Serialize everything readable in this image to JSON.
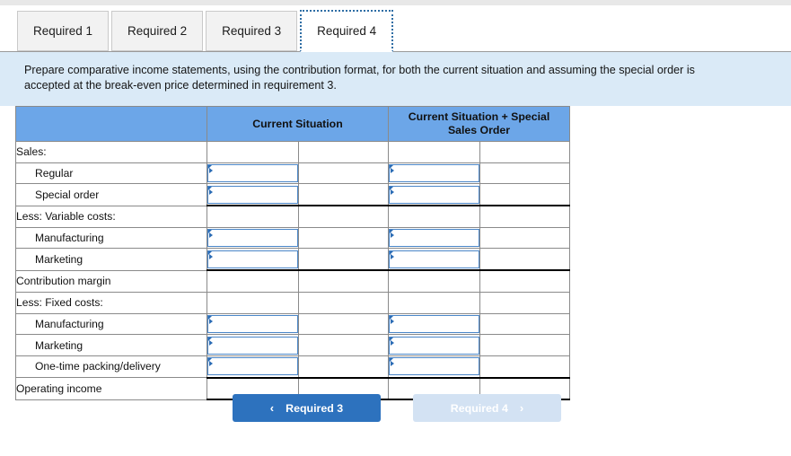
{
  "tabs": [
    {
      "label": "Required 1",
      "active": false
    },
    {
      "label": "Required 2",
      "active": false
    },
    {
      "label": "Required 3",
      "active": false
    },
    {
      "label": "Required 4",
      "active": true
    }
  ],
  "instruction": {
    "text": "Prepare comparative income statements, using the contribution format, for both the current situation and assuming the special order is accepted at the break-even price determined in requirement 3."
  },
  "table": {
    "headers": {
      "blank": "",
      "col1": "Current Situation",
      "col2": "Current Situation + Special Sales Order"
    },
    "rows": [
      {
        "label": "Sales:",
        "indent": false,
        "input": false,
        "heavy": false
      },
      {
        "label": "Regular",
        "indent": true,
        "input": true,
        "heavy": false
      },
      {
        "label": "Special order",
        "indent": true,
        "input": true,
        "heavy": true
      },
      {
        "label": "Less: Variable costs:",
        "indent": false,
        "input": false,
        "heavy": false
      },
      {
        "label": "Manufacturing",
        "indent": true,
        "input": true,
        "heavy": false
      },
      {
        "label": "Marketing",
        "indent": true,
        "input": true,
        "heavy": true
      },
      {
        "label": "Contribution margin",
        "indent": false,
        "input": false,
        "heavy": false
      },
      {
        "label": "Less: Fixed costs:",
        "indent": false,
        "input": false,
        "heavy": false
      },
      {
        "label": "Manufacturing",
        "indent": true,
        "input": true,
        "heavy": false
      },
      {
        "label": "Marketing",
        "indent": true,
        "input": true,
        "heavy": false
      },
      {
        "label": "One-time packing/delivery",
        "indent": true,
        "input": true,
        "heavy": true
      },
      {
        "label": "Operating income",
        "indent": false,
        "input": false,
        "heavy": true
      }
    ]
  },
  "nav": {
    "prev_label": "Required 3",
    "prev_icon": "chevron-left-icon",
    "prev_glyph": "‹",
    "next_label": "Required 4",
    "next_icon": "chevron-right-icon",
    "next_glyph": "›"
  },
  "colors": {
    "header_blue": "#6ca6e8",
    "panel_blue": "#daeaf7",
    "button_blue": "#2d72be",
    "button_disabled": "#d3e2f3",
    "input_border": "#4a86c8"
  }
}
